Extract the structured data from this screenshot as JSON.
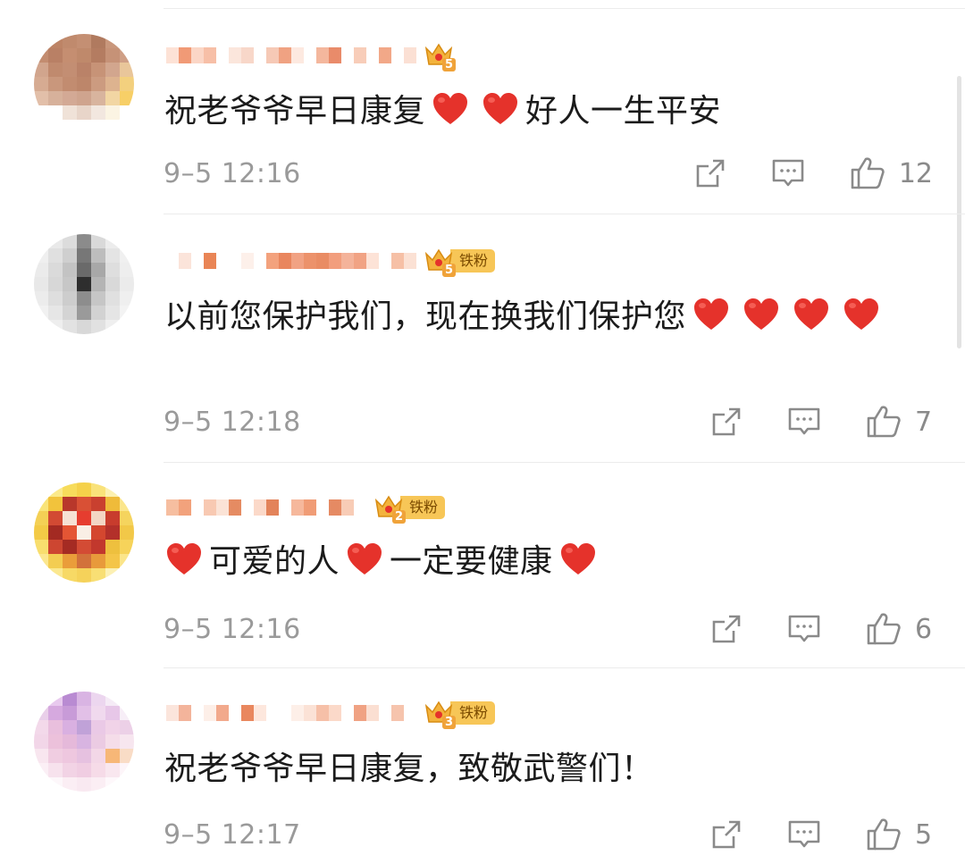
{
  "colors": {
    "heart": "#e5322b",
    "badge_gold": "#f7c657",
    "timestamp": "#9a9a9a",
    "divider": "#ececec"
  },
  "comments": [
    {
      "badge": {
        "icon": "crown-icon",
        "level": "5",
        "fan_label": ""
      },
      "text": [
        {
          "t": "祝老爷爷早日康复"
        },
        {
          "icon": "heart"
        },
        {
          "icon": "heart"
        },
        {
          "t": "好人一生平安"
        }
      ],
      "time": "9–5 12:16",
      "likes": "12"
    },
    {
      "badge": {
        "icon": "crown-icon",
        "level": "5",
        "fan_label": "铁粉"
      },
      "text": [
        {
          "t": "以前您保护我们，现在换我们保护您"
        },
        {
          "icon": "heart"
        },
        {
          "icon": "heart"
        },
        {
          "icon": "heart"
        },
        {
          "icon": "heart"
        }
      ],
      "time": "9–5 12:18",
      "likes": "7"
    },
    {
      "badge": {
        "icon": "crown-icon",
        "level": "2",
        "fan_label": "铁粉"
      },
      "text": [
        {
          "icon": "heart"
        },
        {
          "t": "可爱的人"
        },
        {
          "icon": "heart"
        },
        {
          "t": "一定要健康"
        },
        {
          "icon": "heart"
        }
      ],
      "time": "9–5 12:16",
      "likes": "6"
    },
    {
      "badge": {
        "icon": "crown-icon",
        "level": "3",
        "fan_label": "铁粉"
      },
      "text": [
        {
          "t": "祝老爷爷早日康复，致敬武警们！"
        }
      ],
      "time": "9–5 12:17",
      "likes": "5"
    }
  ]
}
